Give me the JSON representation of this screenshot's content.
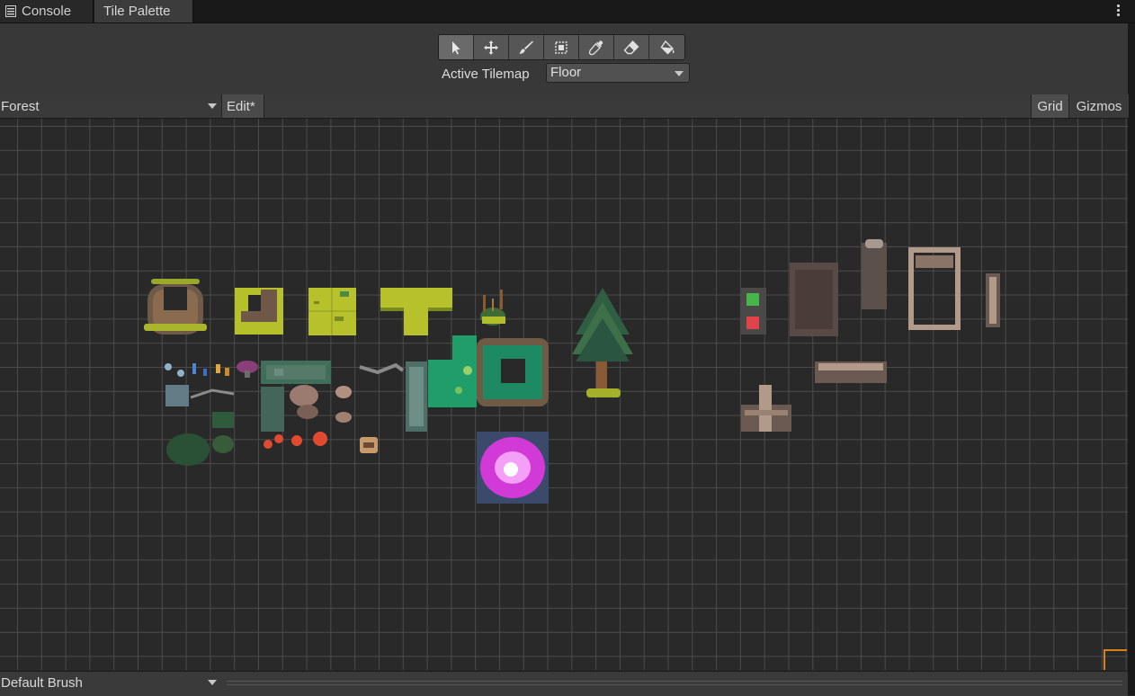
{
  "tabs": [
    {
      "label": "Console",
      "icon": "console-list-icon"
    },
    {
      "label": "Tile Palette"
    }
  ],
  "toolbar": {
    "tools": [
      {
        "name": "select-tool",
        "icon": "arrow-pointer-icon",
        "active": true
      },
      {
        "name": "move-tool",
        "icon": "move-arrows-icon"
      },
      {
        "name": "paint-tool",
        "icon": "paintbrush-icon"
      },
      {
        "name": "box-fill-tool",
        "icon": "box-fill-icon"
      },
      {
        "name": "picker-tool",
        "icon": "eyedropper-icon"
      },
      {
        "name": "erase-tool",
        "icon": "eraser-icon"
      },
      {
        "name": "fill-tool",
        "icon": "paint-bucket-icon"
      }
    ],
    "active_tilemap_label": "Active Tilemap",
    "active_tilemap_value": "Floor"
  },
  "palette_bar": {
    "palette": "Forest",
    "edit_label": "Edit*",
    "grid_label": "Grid",
    "gizmos_label": "Gizmos"
  },
  "bottom_bar": {
    "brush": "Default Brush"
  },
  "colors": {
    "accent_selection": "#d6821c",
    "grass": "#b6c02a",
    "water": "#1f9e6a",
    "stone": "#6b5c54",
    "brick": "#b29a8a",
    "portal": "#d23ad8"
  }
}
